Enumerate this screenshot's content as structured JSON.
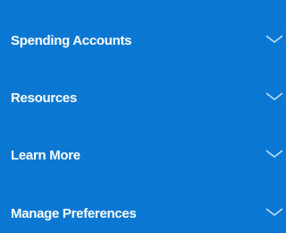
{
  "menu": {
    "items": [
      {
        "label": "Spending Accounts",
        "icon": "chevron-down-icon"
      },
      {
        "label": "Resources",
        "icon": "chevron-down-icon"
      },
      {
        "label": "Learn More",
        "icon": "chevron-down-icon"
      },
      {
        "label": "Manage Preferences",
        "icon": "chevron-down-icon"
      }
    ]
  },
  "colors": {
    "background": "#0a78d2",
    "text": "#ffffff",
    "chevron": "#bfe0fb"
  }
}
